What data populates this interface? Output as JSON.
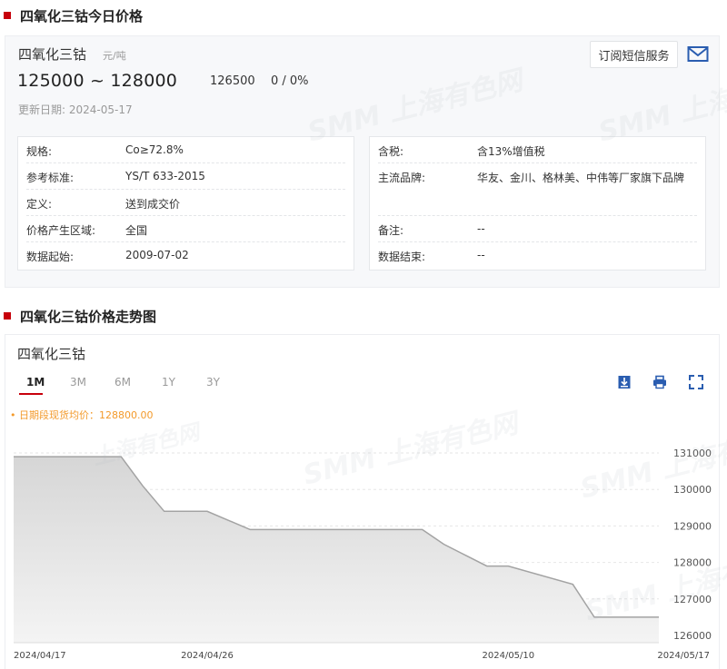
{
  "section1": {
    "title": "四氧化三钴今日价格"
  },
  "product": {
    "name": "四氧化三钴",
    "unit": "元/吨",
    "price_range": "125000 ~ 128000",
    "avg_price": "126500",
    "change": "0 / 0%",
    "update_date": "更新日期: 2024-05-17",
    "subscribe_label": "订阅短信服务"
  },
  "specs_left": [
    {
      "key": "规格:",
      "value": "Co≥72.8%"
    },
    {
      "key": "参考标准:",
      "value": "YS/T 633-2015"
    },
    {
      "key": "定义:",
      "value": "送到成交价"
    },
    {
      "key": "价格产生区域:",
      "value": "全国"
    },
    {
      "key": "数据起始:",
      "value": "2009-07-02"
    }
  ],
  "specs_right": [
    {
      "key": "含税:",
      "value": "含13%增值税"
    },
    {
      "key": "主流品牌:",
      "value": "华友、金川、格林美、中伟等厂家旗下品牌"
    },
    {
      "key": "备注:",
      "value": "--"
    },
    {
      "key": "数据结束:",
      "value": "--"
    }
  ],
  "section2": {
    "title": "四氧化三钴价格走势图"
  },
  "chart_panel": {
    "name": "四氧化三钴",
    "tabs": [
      "1M",
      "3M",
      "6M",
      "1Y",
      "3Y"
    ],
    "active_tab": "1M",
    "avg_note": "• 日期段现货均价：128800.00"
  },
  "watermark": {
    "text": "上海有色网",
    "logo": "SMM"
  },
  "colors": {
    "accent": "#c7000b",
    "note": "#f39a2b",
    "area_fill": "#e3e3e3",
    "line": "#a3a3a3"
  },
  "icons": [
    "mail-icon",
    "download-icon",
    "print-icon",
    "fullscreen-icon"
  ],
  "chart_data": {
    "type": "area",
    "x": [
      "2024-04-17",
      "2024-04-19",
      "2024-04-22",
      "2024-04-23",
      "2024-04-24",
      "2024-04-25",
      "2024-04-26",
      "2024-04-28",
      "2024-04-29",
      "2024-04-30",
      "2024-05-06",
      "2024-05-07",
      "2024-05-08",
      "2024-05-09",
      "2024-05-10",
      "2024-05-13",
      "2024-05-14",
      "2024-05-15",
      "2024-05-16",
      "2024-05-17"
    ],
    "values": [
      130900,
      130900,
      130900,
      130100,
      129400,
      129400,
      129400,
      128900,
      128900,
      128900,
      128900,
      128500,
      128200,
      127900,
      127900,
      127400,
      126500,
      126500,
      126500,
      126500
    ],
    "xticks": [
      "2024/04/17",
      "2024/04/26",
      "2024/05/10",
      "2024/05/17"
    ],
    "yticks": [
      126000,
      127000,
      128000,
      129000,
      130000,
      131000
    ],
    "ylim": [
      125800,
      131200
    ],
    "grid": true,
    "title": "",
    "xlabel": "",
    "ylabel": ""
  }
}
